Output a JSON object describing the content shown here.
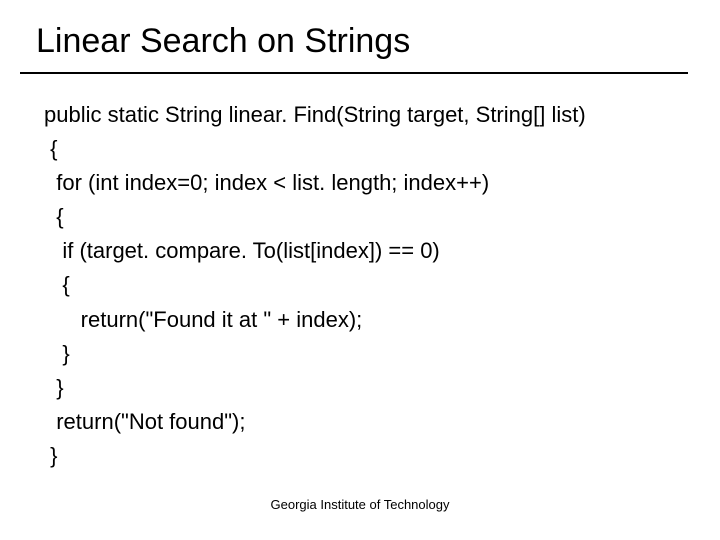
{
  "title": "Linear Search on Strings",
  "code": {
    "l1": "public static String linear. Find(String target, String[] list)",
    "l2": " {",
    "l3": "  for (int index=0; index < list. length; index++)",
    "l4": "  {",
    "l5": "   if (target. compare. To(list[index]) == 0)",
    "l6": "   {",
    "l7": "      return(\"Found it at \" + index);",
    "l8": "   }",
    "l9": "  }",
    "l10": "  return(\"Not found\");",
    "l11": " }"
  },
  "footer": "Georgia Institute of Technology"
}
